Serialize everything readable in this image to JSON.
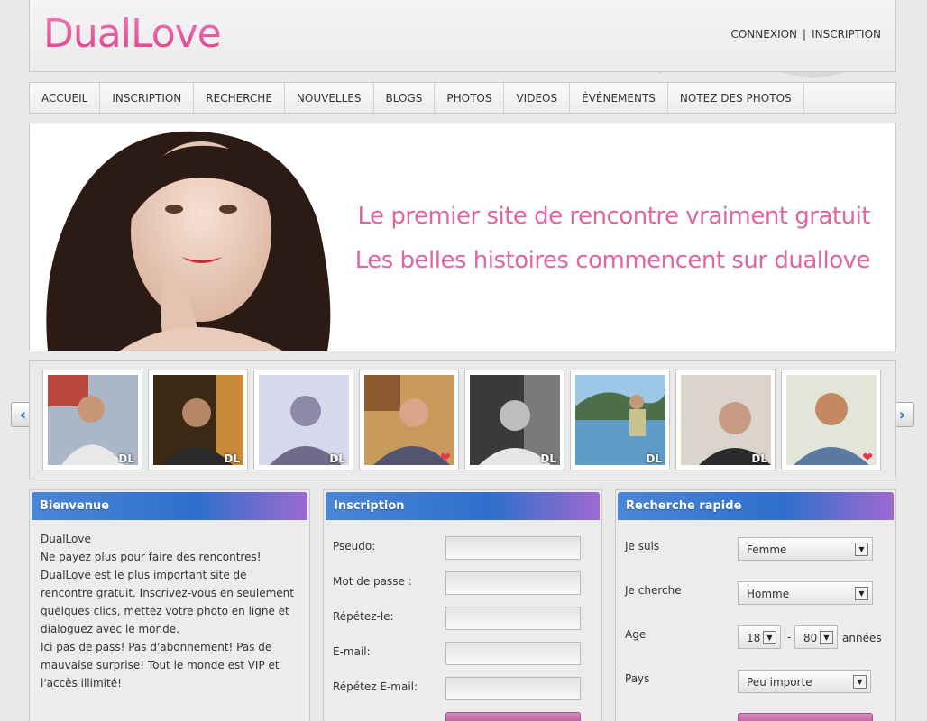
{
  "header": {
    "logo": "DualLove",
    "login": "CONNEXION",
    "separator": "|",
    "register": "INSCRIPTION"
  },
  "nav": [
    {
      "label": "ACCUEIL"
    },
    {
      "label": "INSCRIPTION"
    },
    {
      "label": "RECHERCHE"
    },
    {
      "label": "NOUVELLES"
    },
    {
      "label": "BLOGS"
    },
    {
      "label": "PHOTOS"
    },
    {
      "label": "VIDEOS"
    },
    {
      "label": "ÉVÉNEMENTS"
    },
    {
      "label": "NOTEZ DES PHOTOS"
    }
  ],
  "banner": {
    "line1": "Le premier site de rencontre vraiment gratuit",
    "line2": "Les belles histoires commencent sur duallove"
  },
  "carousel": {
    "badge": "DL",
    "thumbs": [
      {
        "mark": "dl"
      },
      {
        "mark": "dl"
      },
      {
        "mark": "dl"
      },
      {
        "mark": "heart"
      },
      {
        "mark": "dl"
      },
      {
        "mark": "dl"
      },
      {
        "mark": "dl"
      },
      {
        "mark": "heart"
      }
    ]
  },
  "welcome": {
    "title": "Bienvenue",
    "p1": "DualLove",
    "p2": "Ne payez plus pour faire des rencontres! DualLove est le plus important site de rencontre gratuit. Inscrivez-vous en seulement quelques clics, mettez votre photo en ligne et dialoguez avec le monde.",
    "p3": "Ici pas de pass! Pas d'abonnement! Pas de mauvaise surprise! Tout le monde est VIP et l'accès illimité!"
  },
  "signup": {
    "title": "Inscription",
    "pseudo": "Pseudo:",
    "password": "Mot de passe :",
    "repeat": "Répétez-le:",
    "email": "E-mail:",
    "repeat_email": "Répétez E-mail:"
  },
  "search": {
    "title": "Recherche rapide",
    "i_am_label": "Je suis",
    "i_am_value": "Femme",
    "seeking_label": "Je cherche",
    "seeking_value": "Homme",
    "age_label": "Age",
    "age_min": "18",
    "age_dash": "-",
    "age_max": "80",
    "age_unit": "années",
    "country_label": "Pays",
    "country_value": "Peu importe"
  },
  "colors": {
    "brand_pink": "#e8559c",
    "panel_blue": "#2f6fcc",
    "panel_purple": "#9e6ad0"
  }
}
